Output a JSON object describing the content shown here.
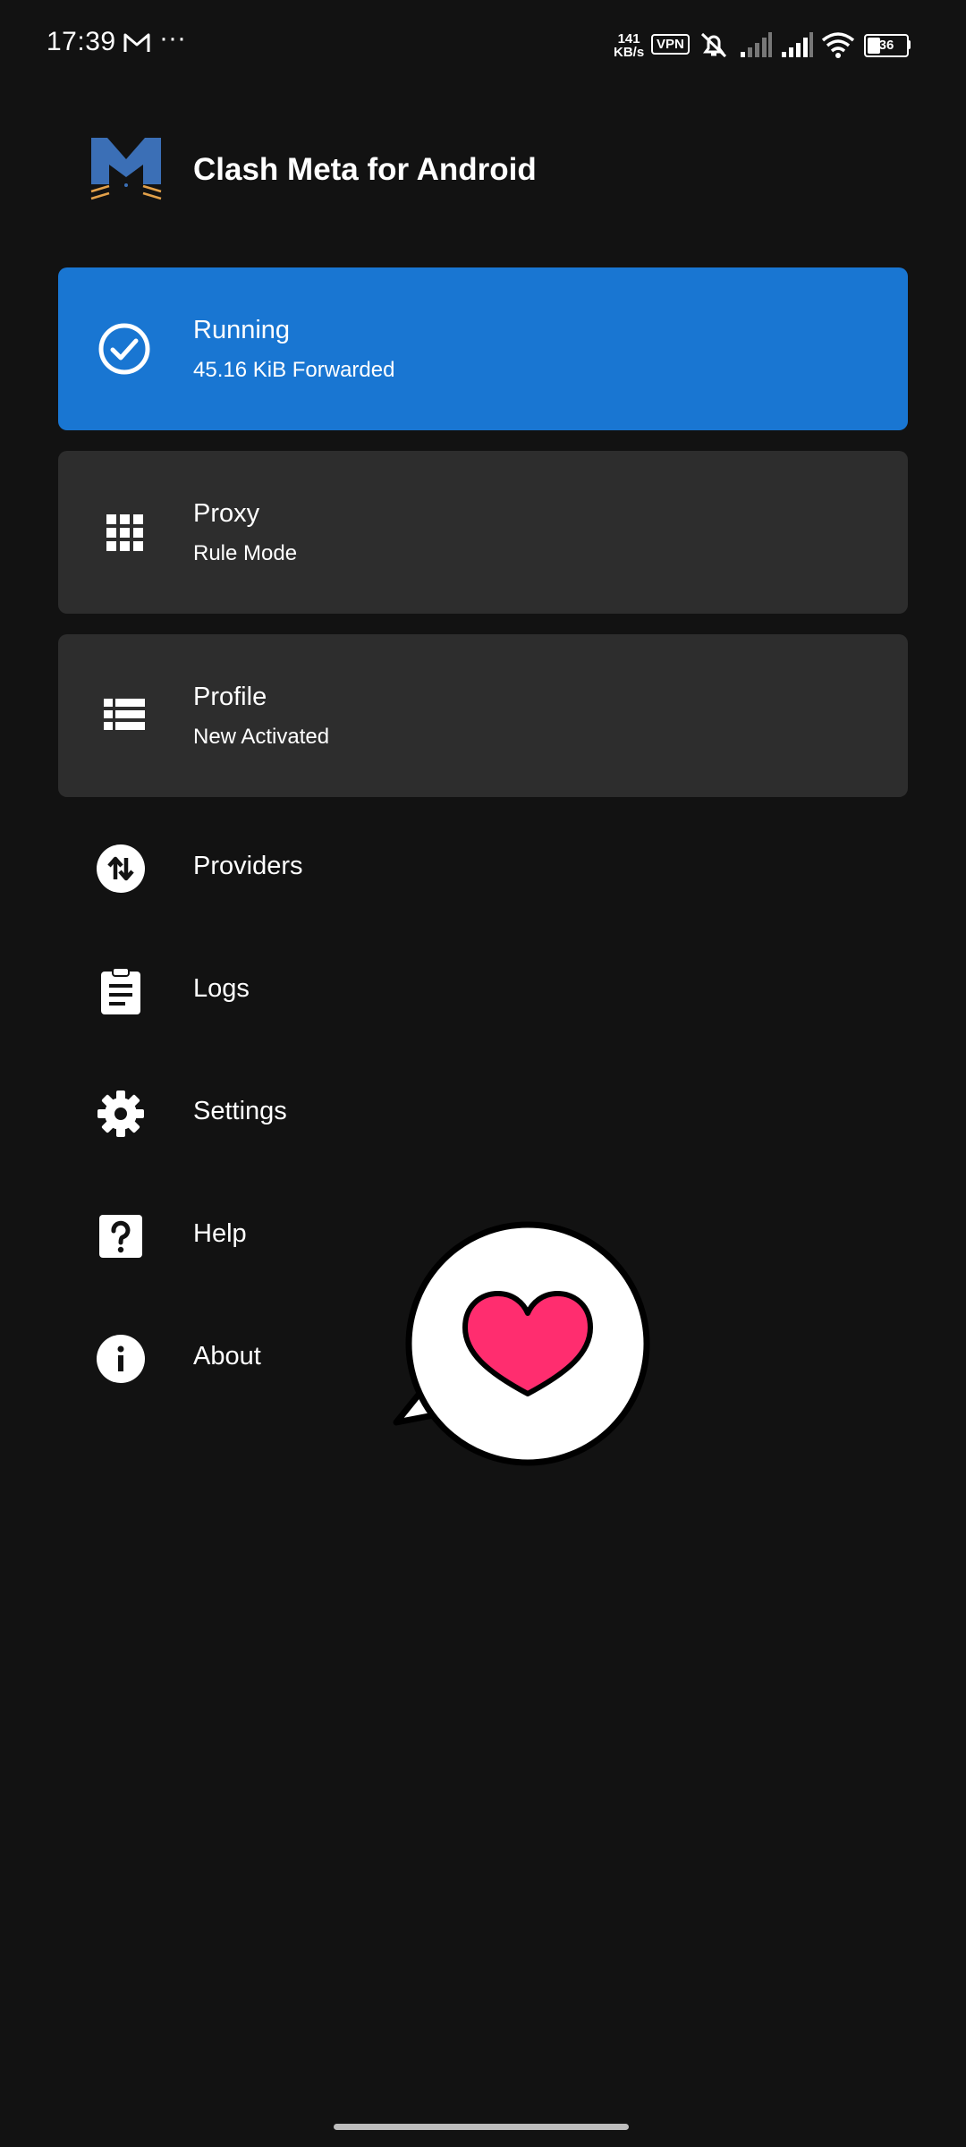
{
  "status_bar": {
    "time": "17:39",
    "more": "···",
    "speed_value": "141",
    "speed_unit": "KB/s",
    "vpn": "VPN",
    "battery": "36"
  },
  "header": {
    "title": "Clash Meta for Android",
    "logo_icon": "clash-meta-cat-logo"
  },
  "cards": {
    "running": {
      "title": "Running",
      "subtitle": "45.16 KiB Forwarded",
      "icon": "check-circle-icon",
      "color": "#1976d2"
    },
    "proxy": {
      "title": "Proxy",
      "subtitle": "Rule Mode",
      "icon": "grid-icon"
    },
    "profile": {
      "title": "Profile",
      "subtitle": "New Activated",
      "icon": "list-icon"
    }
  },
  "menu": {
    "providers": {
      "label": "Providers",
      "icon": "swap-vertical-icon"
    },
    "logs": {
      "label": "Logs",
      "icon": "clipboard-icon"
    },
    "settings": {
      "label": "Settings",
      "icon": "gear-icon"
    },
    "help": {
      "label": "Help",
      "icon": "help-icon"
    },
    "about": {
      "label": "About",
      "icon": "info-icon"
    }
  },
  "overlay": {
    "icon": "heart-bubble-icon",
    "heart_color": "#ff2d6f"
  },
  "colors": {
    "background": "#121212",
    "card": "#2d2d2d",
    "accent": "#1976d2"
  }
}
